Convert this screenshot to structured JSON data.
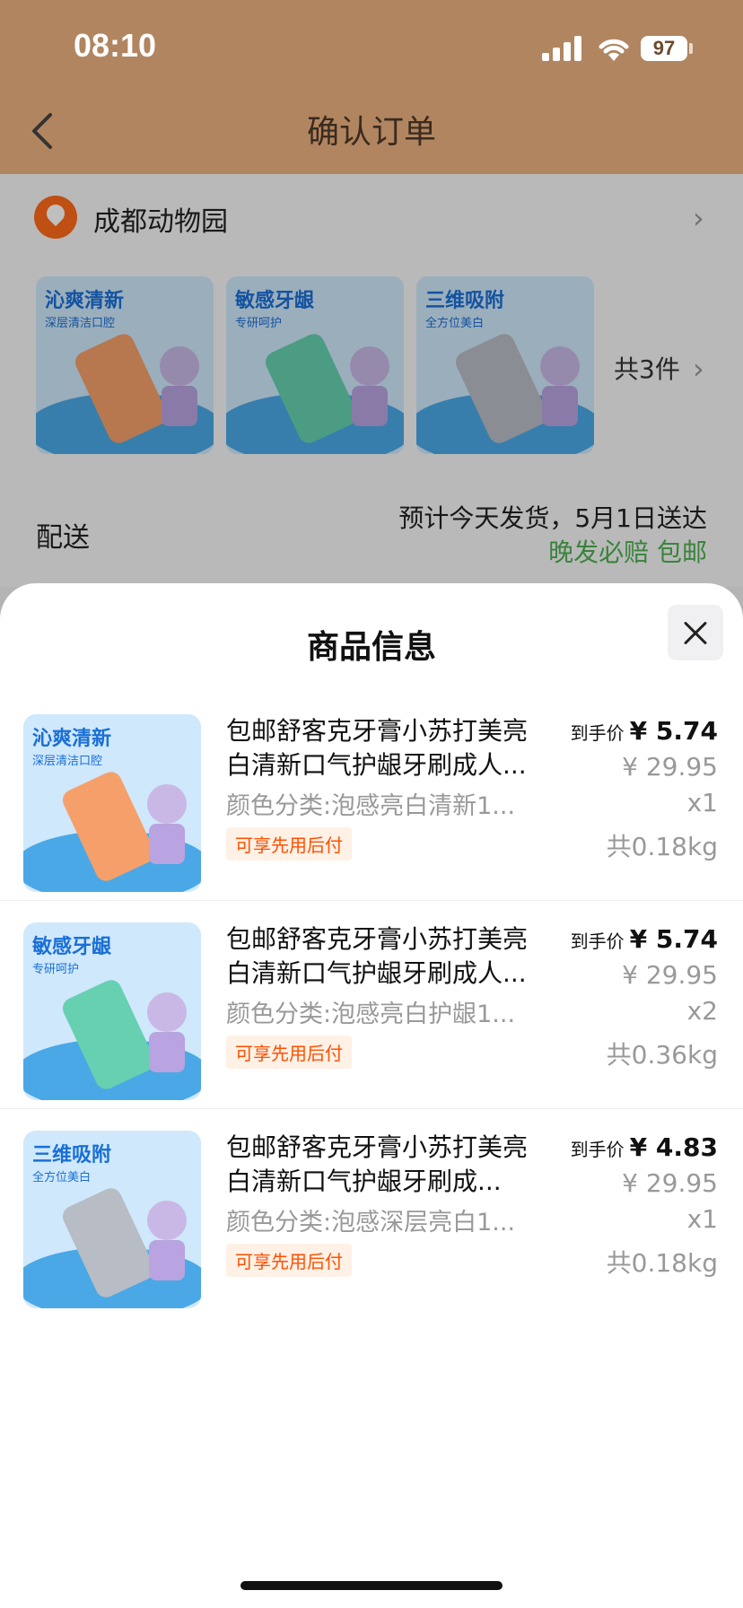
{
  "status": {
    "time": "08:10",
    "battery": "97"
  },
  "header": {
    "title": "确认订单"
  },
  "order": {
    "address": "成都动物园",
    "item_count": "共3件",
    "shipping_label": "配送",
    "shipping_estimate": "预计今天发货，5月1日送达",
    "shipping_tags": "晚发必赔  包邮",
    "thumbs": [
      {
        "headline": "沁爽清新",
        "sub": "深层清洁口腔"
      },
      {
        "headline": "敏感牙龈",
        "sub": "专研呵护"
      },
      {
        "headline": "三维吸附",
        "sub": "全方位美白"
      }
    ]
  },
  "sheet": {
    "title": "商品信息",
    "items": [
      {
        "name": "包邮舒客克牙膏小苏打美亮白清新口气护龈牙刷成人...",
        "variant": "颜色分类:泡感亮白清新1...",
        "badge": "可享先用后付",
        "price_label": "到手价",
        "price": "¥ 5.74",
        "original_price": "¥ 29.95",
        "qty": "x1",
        "weight": "共0.18kg",
        "img_headline": "沁爽清新",
        "img_sub": "深层清洁口腔"
      },
      {
        "name": "包邮舒客克牙膏小苏打美亮白清新口气护龈牙刷成人...",
        "variant": "颜色分类:泡感亮白护龈1...",
        "badge": "可享先用后付",
        "price_label": "到手价",
        "price": "¥ 5.74",
        "original_price": "¥ 29.95",
        "qty": "x2",
        "weight": "共0.36kg",
        "img_headline": "敏感牙龈",
        "img_sub": "专研呵护"
      },
      {
        "name": "包邮舒客克牙膏小苏打美亮白清新口气护龈牙刷成...",
        "variant": "颜色分类:泡感深层亮白1...",
        "badge": "可享先用后付",
        "price_label": "到手价",
        "price": "¥ 4.83",
        "original_price": "¥ 29.95",
        "qty": "x1",
        "weight": "共0.18kg",
        "img_headline": "三维吸附",
        "img_sub": "全方位美白"
      }
    ]
  },
  "colors": {
    "header_bg": "#b08560",
    "accent": "#ff5000",
    "green": "#4caf50",
    "thumb_1": "#f5a06a",
    "thumb_2": "#66d0b0",
    "thumb_3": "#b8bcc4"
  }
}
